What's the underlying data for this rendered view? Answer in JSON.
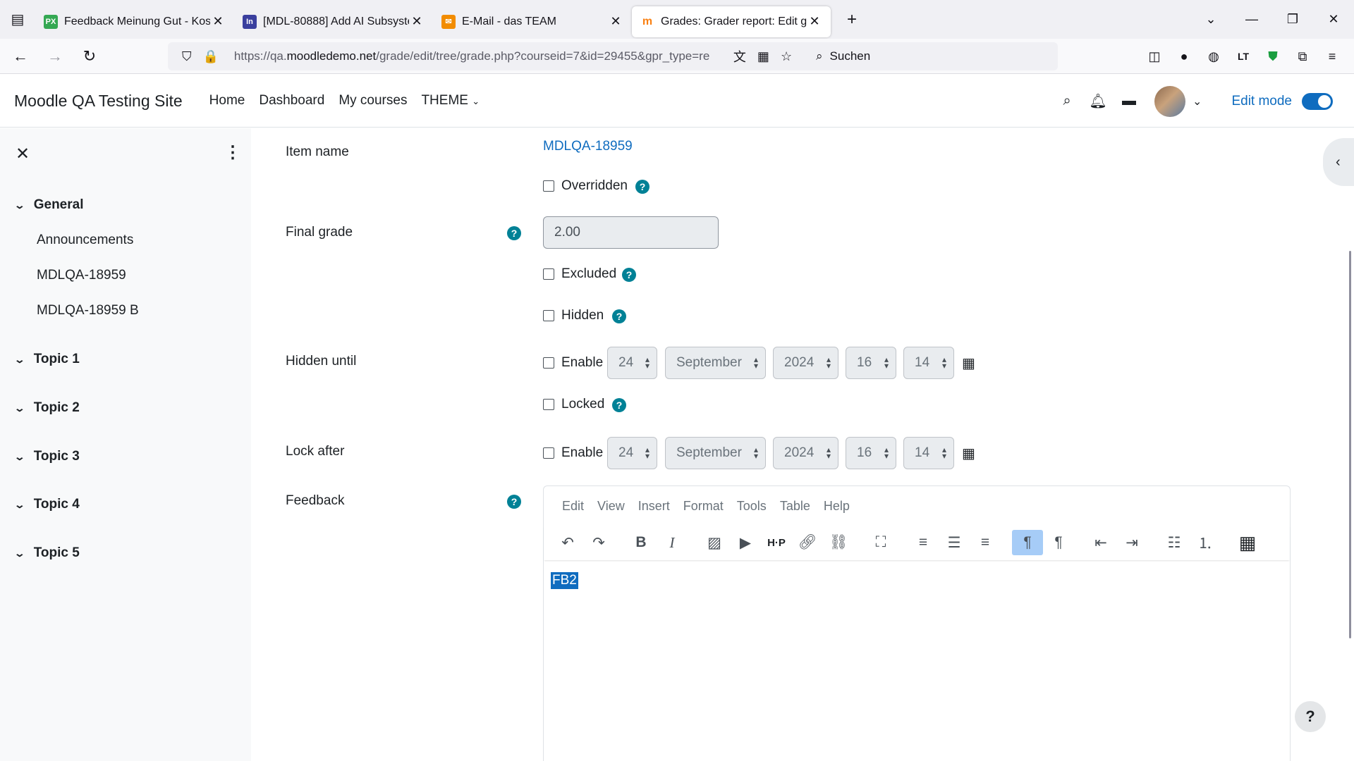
{
  "browser": {
    "tabs": [
      {
        "title": "Feedback Meinung Gut - Kosten",
        "favicon": "PX",
        "color": "#34a853"
      },
      {
        "title": "[MDL-80888] Add AI Subsystem",
        "favicon": "In",
        "color": "#3a3f9e"
      },
      {
        "title": "E-Mail - das TEAM",
        "favicon": "✉",
        "color": "#f28c00"
      },
      {
        "title": "Grades: Grader report: Edit grad",
        "favicon": "m",
        "color": "#f98012",
        "active": true
      }
    ],
    "url_prefix": "https://qa.",
    "url_domain": "moodledemo.net",
    "url_rest": "/grade/edit/tree/grade.php?courseid=7&id=29455&gpr_type=re",
    "search_placeholder": "Suchen"
  },
  "header": {
    "site_name": "Moodle QA Testing Site",
    "nav": [
      "Home",
      "Dashboard",
      "My courses",
      "THEME"
    ],
    "edit_mode_label": "Edit mode"
  },
  "drawer": {
    "sections": [
      {
        "title": "General",
        "items": [
          "Announcements",
          "MDLQA-18959",
          "MDLQA-18959 B"
        ]
      },
      {
        "title": "Topic 1"
      },
      {
        "title": "Topic 2"
      },
      {
        "title": "Topic 3"
      },
      {
        "title": "Topic 4"
      },
      {
        "title": "Topic 5"
      }
    ]
  },
  "form": {
    "item_name_label": "Item name",
    "item_name_value": "MDLQA-18959",
    "overridden_label": "Overridden",
    "final_grade_label": "Final grade",
    "final_grade_value": "2.00",
    "excluded_label": "Excluded",
    "hidden_label": "Hidden",
    "hidden_until_label": "Hidden until",
    "enable_label": "Enable",
    "locked_label": "Locked",
    "lock_after_label": "Lock after",
    "date": {
      "day": "24",
      "month": "September",
      "year": "2024",
      "hour": "16",
      "minute": "14"
    },
    "feedback_label": "Feedback",
    "editor_menu": [
      "Edit",
      "View",
      "Insert",
      "Format",
      "Tools",
      "Table",
      "Help"
    ],
    "editor_content": "FB2"
  }
}
